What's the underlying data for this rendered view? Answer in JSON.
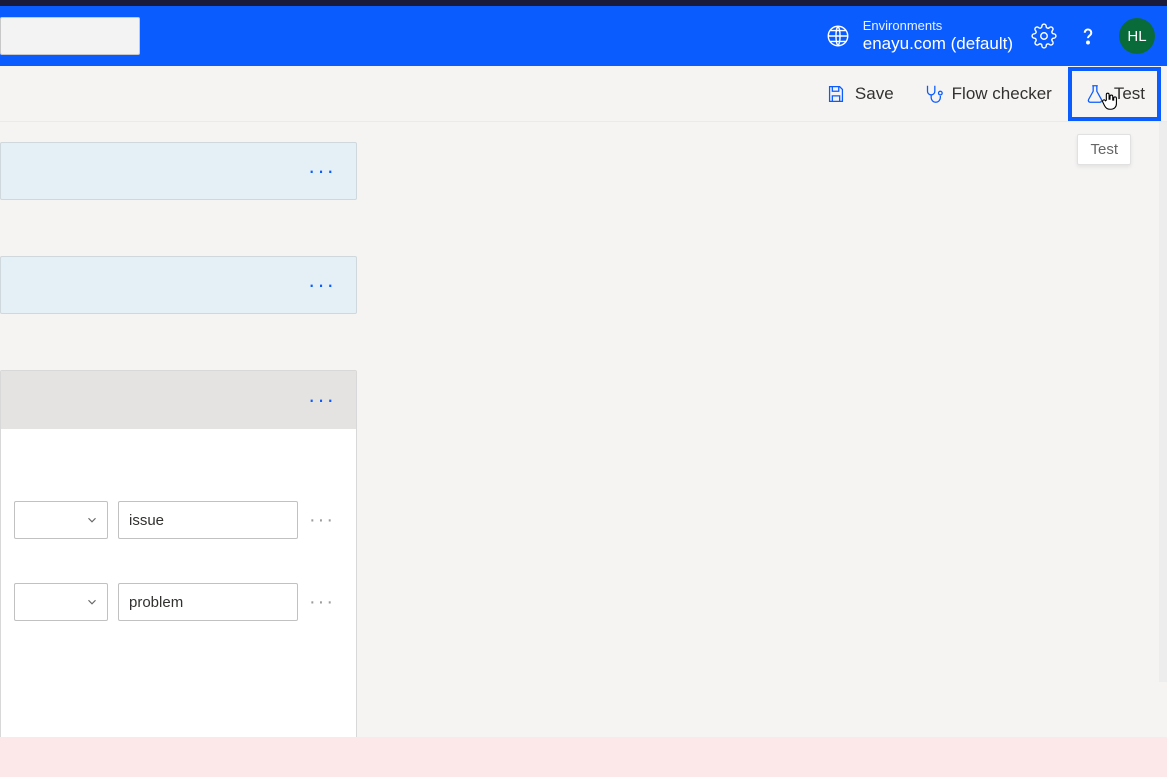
{
  "header": {
    "search_value": "",
    "env_label": "Environments",
    "env_value": "enayu.com (default)",
    "avatar_initials": "HL"
  },
  "toolbar": {
    "save_label": "Save",
    "flowchecker_label": "Flow checker",
    "test_label": "Test",
    "tooltip_text": "Test"
  },
  "flow": {
    "condition_rows": [
      {
        "value": "issue"
      },
      {
        "value": "problem"
      }
    ]
  }
}
